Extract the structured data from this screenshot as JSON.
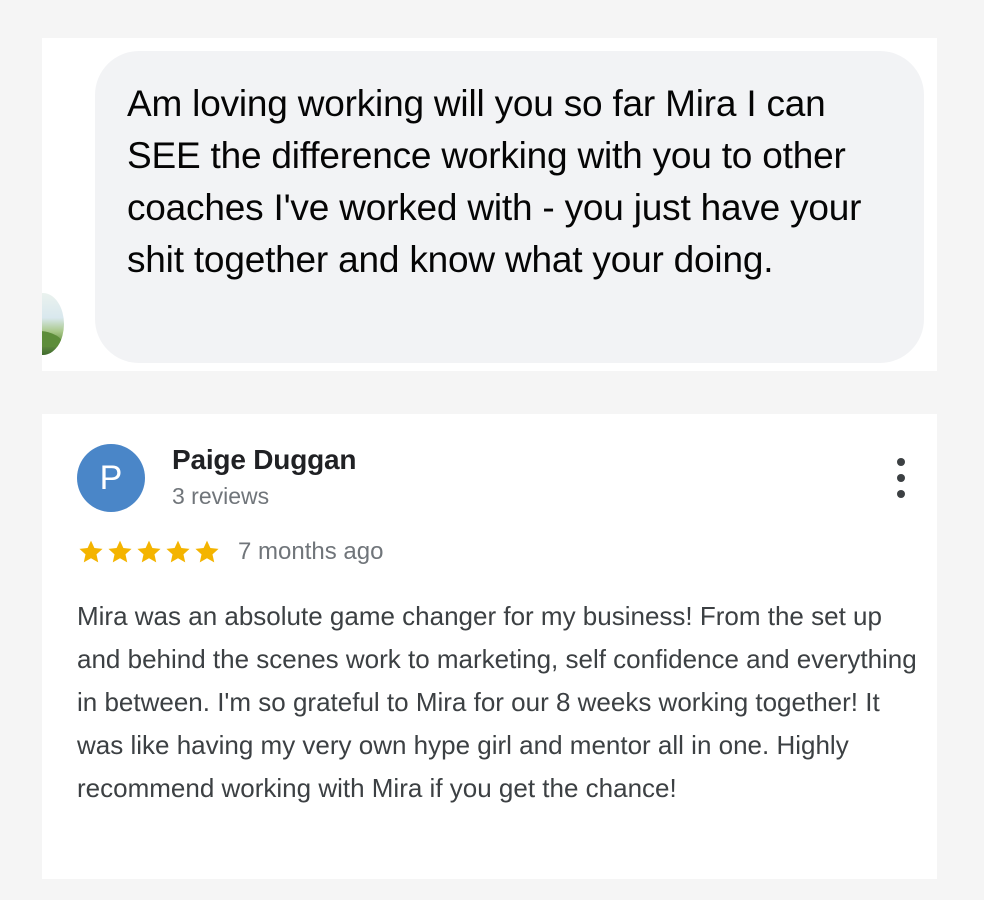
{
  "message": {
    "text": "Am loving working will you so far Mira I can SEE the difference working with you to other coaches I've worked with - you just have your shit together and know what your doing."
  },
  "review": {
    "avatar_letter": "P",
    "reviewer_name": "Paige Duggan",
    "reviewer_meta": "3 reviews",
    "rating": 5,
    "rating_max": 5,
    "date": "7 months ago",
    "text": "Mira was an absolute game changer for my business! From the set up and behind the scenes work to marketing, self confidence and everything in between. I'm so grateful to Mira for our 8 weeks working together! It was like having my very own hype girl and mentor all in one. Highly recommend working with Mira if you get the chance!",
    "more_icon": "more-vert-icon",
    "star_icon": "star-icon"
  },
  "colors": {
    "star": "#f4b400",
    "avatar_bg": "#4a86c8",
    "bubble_bg": "#f2f3f5"
  }
}
